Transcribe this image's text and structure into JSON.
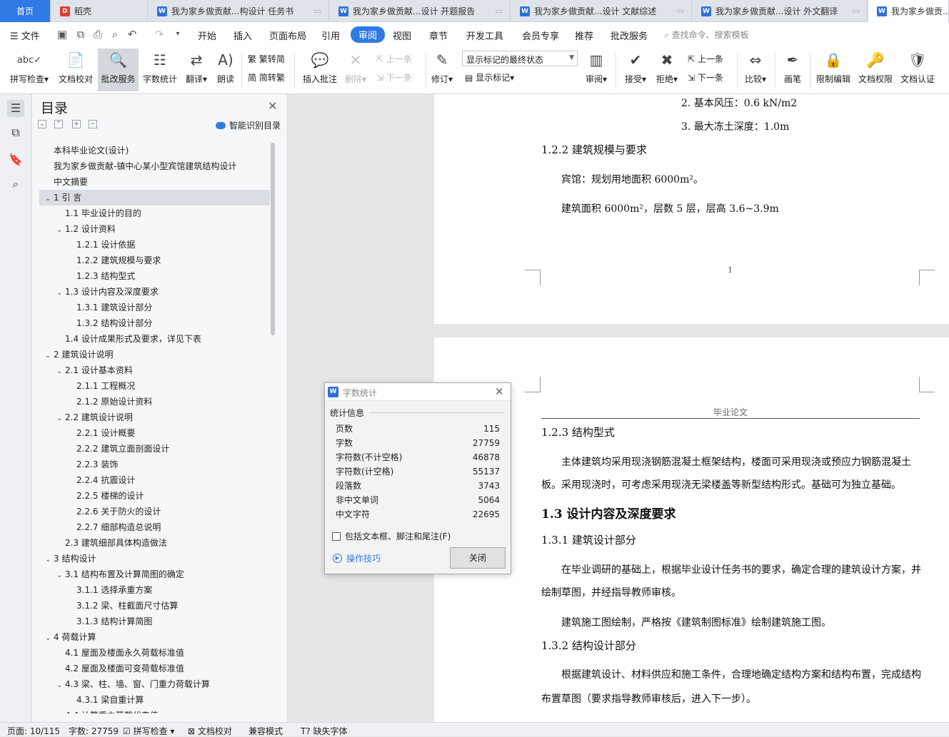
{
  "tabs": [
    {
      "label": "首页",
      "icon": "home"
    },
    {
      "label": "稻壳",
      "icon": "docer-logo-icon"
    },
    {
      "label": "我为家乡做贡献...构设计 任务书",
      "icon": "word-doc-icon"
    },
    {
      "label": "我为家乡做贡献...设计 开题报告",
      "icon": "word-doc-icon"
    },
    {
      "label": "我为家乡做贡献...设计 文献综述",
      "icon": "word-doc-icon"
    },
    {
      "label": "我为家乡做贡献...设计 外文翻译",
      "icon": "word-doc-icon"
    },
    {
      "label": "我为家乡做贡...",
      "icon": "word-doc-icon"
    }
  ],
  "menu": {
    "file": "文件",
    "items": [
      "开始",
      "插入",
      "页面布局",
      "引用",
      "审阅",
      "视图",
      "章节",
      "开发工具",
      "会员专享",
      "推荐",
      "批改服务"
    ],
    "active": "审阅",
    "search_placeholder": "查找命令、搜索模板"
  },
  "ribbon": {
    "spell": "拼写检查",
    "proof": "文档校对",
    "review_service": "批改服务",
    "word_count": "字数统计",
    "translate": "翻译",
    "read": "朗读",
    "trad": "繁转简",
    "simp": "简转繁",
    "insert_comment": "插入批注",
    "delete": "删除",
    "prev": "上一条",
    "next": "下一条",
    "track": "修订",
    "markup_state": "显示标记的最终状态",
    "show_markup": "显示标记",
    "review": "审阅",
    "accept": "接受",
    "reject": "拒绝",
    "prev2": "上一条",
    "next2": "下一条",
    "compare": "比较",
    "pen": "画笔",
    "restrict": "限制编辑",
    "permission": "文档权限",
    "certify": "文档认证"
  },
  "nav": {
    "title": "目录",
    "smart": "智能识别目录",
    "items": [
      {
        "text": "本科毕业论文(设计)",
        "level": 0,
        "caret": ""
      },
      {
        "text": "我为家乡做贡献-镇中心某小型宾馆建筑结构设计",
        "level": 0,
        "caret": ""
      },
      {
        "text": "中文摘要",
        "level": 0,
        "caret": ""
      },
      {
        "text": "1 引 言",
        "level": 0,
        "caret": "v",
        "selected": true
      },
      {
        "text": "1.1  毕业设计的目的",
        "level": 1,
        "caret": ""
      },
      {
        "text": "1.2  设计资料",
        "level": 1,
        "caret": "v"
      },
      {
        "text": "1.2.1  设计依据",
        "level": 2,
        "caret": ""
      },
      {
        "text": "1.2.2  建筑规模与要求",
        "level": 2,
        "caret": ""
      },
      {
        "text": "1.2.3  结构型式",
        "level": 2,
        "caret": ""
      },
      {
        "text": "1.3  设计内容及深度要求",
        "level": 1,
        "caret": "v"
      },
      {
        "text": "1.3.1  建筑设计部分",
        "level": 2,
        "caret": ""
      },
      {
        "text": "1.3.2  结构设计部分",
        "level": 2,
        "caret": ""
      },
      {
        "text": "1.4  设计成果形式及要求，详见下表",
        "level": 1,
        "caret": ""
      },
      {
        "text": "2 建筑设计说明",
        "level": 0,
        "caret": "v"
      },
      {
        "text": "2.1  设计基本资料",
        "level": 1,
        "caret": "v"
      },
      {
        "text": "2.1.1  工程概况",
        "level": 2,
        "caret": ""
      },
      {
        "text": "2.1.2  原始设计资料",
        "level": 2,
        "caret": ""
      },
      {
        "text": "2.2    建筑设计说明",
        "level": 1,
        "caret": "v"
      },
      {
        "text": "2.2.1  设计概要",
        "level": 2,
        "caret": ""
      },
      {
        "text": "2.2.2  建筑立面剖面设计",
        "level": 2,
        "caret": ""
      },
      {
        "text": "2.2.3  装饰",
        "level": 2,
        "caret": ""
      },
      {
        "text": "2.2.4 抗震设计",
        "level": 2,
        "caret": ""
      },
      {
        "text": "2.2.5 楼梯的设计",
        "level": 2,
        "caret": ""
      },
      {
        "text": "2.2.6 关于防火的设计",
        "level": 2,
        "caret": ""
      },
      {
        "text": "2.2.7 细部构造总说明",
        "level": 2,
        "caret": ""
      },
      {
        "text": "2.3  建筑细部具体构造做法",
        "level": 1,
        "caret": ""
      },
      {
        "text": "3  结构设计",
        "level": 0,
        "caret": "v"
      },
      {
        "text": "3.1  结构布置及计算简图的确定",
        "level": 1,
        "caret": "v"
      },
      {
        "text": "3.1.1  选择承重方案",
        "level": 2,
        "caret": ""
      },
      {
        "text": "3.1.2  梁、柱截面尺寸估算",
        "level": 2,
        "caret": ""
      },
      {
        "text": "3.1.3  结构计算简图",
        "level": 2,
        "caret": ""
      },
      {
        "text": "4  荷载计算",
        "level": 0,
        "caret": "v"
      },
      {
        "text": "4.1  屋面及楼面永久荷载标准值",
        "level": 1,
        "caret": ""
      },
      {
        "text": "4.2    屋面及楼面可变荷载标准值",
        "level": 1,
        "caret": ""
      },
      {
        "text": "4.3    梁、柱、墙、窗、门重力荷载计算",
        "level": 1,
        "caret": "v"
      },
      {
        "text": "4.3.1  梁自重计算",
        "level": 2,
        "caret": ""
      },
      {
        "text": "4.4    计算重力荷载代表值",
        "level": 1,
        "caret": "v"
      }
    ]
  },
  "doc": {
    "page1": {
      "l1": "2.  基本风压：0.6 kN/m2",
      "l2": "3.  最大冻土深度：1.0m",
      "h122": "1.2.2  建筑规模与要求",
      "p1": "宾馆：规划用地面积 6000m²。",
      "p2": "建筑面积 6000m²，层数 5 层，层高 3.6~3.9m",
      "pagenum": "1"
    },
    "page2": {
      "header": "毕业论文",
      "h123": "1.2.3  结构型式",
      "p1": "主体建筑均采用现浇钢筋混凝土框架结构，楼面可采用现浇或预应力钢筋混凝土",
      "p2": "板。采用现浇时，可考虑采用现浇无梁楼盖等新型结构形式。基础可为独立基础。",
      "h13": "1.3   设计内容及深度要求",
      "h131": "1.3.1  建筑设计部分",
      "p3": "在毕业调研的基础上，根据毕业设计任务书的要求，确定合理的建筑设计方案，并",
      "p4": "绘制草图，并经指导教师审核。",
      "p5": "建筑施工图绘制，严格按《建筑制图标准》绘制建筑施工图。",
      "h132": "1.3.2  结构设计部分",
      "p6": "根据建筑设计、材料供应和施工条件，合理地确定结构方案和结构布置，完成结构",
      "p7": "布置草图（要求指导教师审核后，进入下一步）。"
    }
  },
  "wordcount": {
    "title": "字数统计",
    "section": "统计信息",
    "rows": [
      {
        "label": "页数",
        "value": "115"
      },
      {
        "label": "字数",
        "value": "27759"
      },
      {
        "label": "字符数(不计空格)",
        "value": "46878"
      },
      {
        "label": "字符数(计空格)",
        "value": "55137"
      },
      {
        "label": "段落数",
        "value": "3743"
      },
      {
        "label": "非中文单词",
        "value": "5064"
      },
      {
        "label": "中文字符",
        "value": "22695"
      }
    ],
    "include_label": "包括文本框、脚注和尾注(F)",
    "tips": "操作技巧",
    "close": "关闭"
  },
  "status": {
    "page": "页面: 10/115",
    "words": "字数: 27759",
    "spell": "拼写检查",
    "proof": "文档校对",
    "compat": "兼容模式",
    "missing_font": "缺失字体"
  },
  "colors": {
    "accent": "#2f7ae5",
    "tab_bar": "#dfe3ea",
    "doc_bg": "#e6e6e6"
  }
}
